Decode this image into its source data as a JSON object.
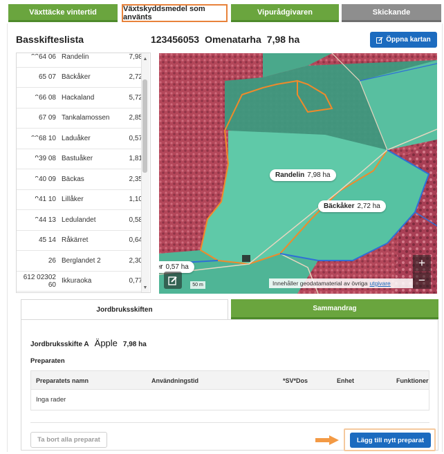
{
  "top_tabs": [
    {
      "label": "Växttäcke vintertid",
      "state": "green"
    },
    {
      "label": "Växtskyddsmedel som använts",
      "state": "active"
    },
    {
      "label": "Vipurådgivaren",
      "state": "green"
    },
    {
      "label": "Skickande",
      "state": "grey"
    }
  ],
  "parcel_list": {
    "title": "Basskifteslista",
    "rows": [
      {
        "code": "0064 06",
        "name": "Randelin",
        "ha": "7,98"
      },
      {
        "code": "65 07",
        "name": "Bäckåker",
        "ha": "2,72"
      },
      {
        "code": "066 08",
        "name": "Hackaland",
        "ha": "5,72"
      },
      {
        "code": "67 09",
        "name": "Tankalamossen",
        "ha": "2,85"
      },
      {
        "code": "0068 10",
        "name": "Laduåker",
        "ha": "0,57"
      },
      {
        "code": "939 08",
        "name": "Bastuåker",
        "ha": "1,81"
      },
      {
        "code": "940 09",
        "name": "Bäckas",
        "ha": "2,35"
      },
      {
        "code": "941 10",
        "name": "Lillåker",
        "ha": "1,10"
      },
      {
        "code": "944 13",
        "name": "Ledulandet",
        "ha": "0,58"
      },
      {
        "code": "45 14",
        "name": "Råkärret",
        "ha": "0,64"
      },
      {
        "code": "26",
        "name": "Berglandet 2",
        "ha": "2,30"
      },
      {
        "code": "612 02302 60",
        "name": "Ikkuraoka",
        "ha": "0,77"
      }
    ]
  },
  "field_header": {
    "id": "123456053",
    "name": "Omenatarha",
    "area": "7,98 ha"
  },
  "map_button": {
    "label": "Öppna kartan",
    "icon": "edit-icon"
  },
  "map": {
    "labels": [
      {
        "name": "Randelin",
        "area": "7,98 ha"
      },
      {
        "name": "Bäckåker",
        "area": "2,72 ha"
      },
      {
        "name": "er",
        "area": "0,57 ha"
      }
    ],
    "zoom_in": "+",
    "zoom_out": "−",
    "scale": "50 m",
    "attribution_text": "Innehåller geodatamaterial av övriga",
    "attribution_link": "utgivare"
  },
  "lower_tabs": {
    "active": "Jordbruksskiften",
    "inactive": "Sammandrag"
  },
  "panel": {
    "field_label": "Jordbruksskifte A",
    "crop": "Äpple",
    "area": "7,98 ha",
    "section_label": "Preparaten",
    "columns": [
      "Preparatets namn",
      "Användningstid",
      "*SV*Dos",
      "Enhet",
      "Funktioner"
    ],
    "empty_text": "Inga rader",
    "remove_all_label": "Ta bort alla preparat",
    "add_label": "Lägg till nytt preparat"
  },
  "colors": {
    "green_tab": "#6aa53e",
    "blue_button": "#1c6bbf",
    "highlight_orange": "#e8823a",
    "field_fill": "#5fc9a8",
    "field_border": "#f08a2a",
    "ditch_blue": "#2f6fd6"
  }
}
